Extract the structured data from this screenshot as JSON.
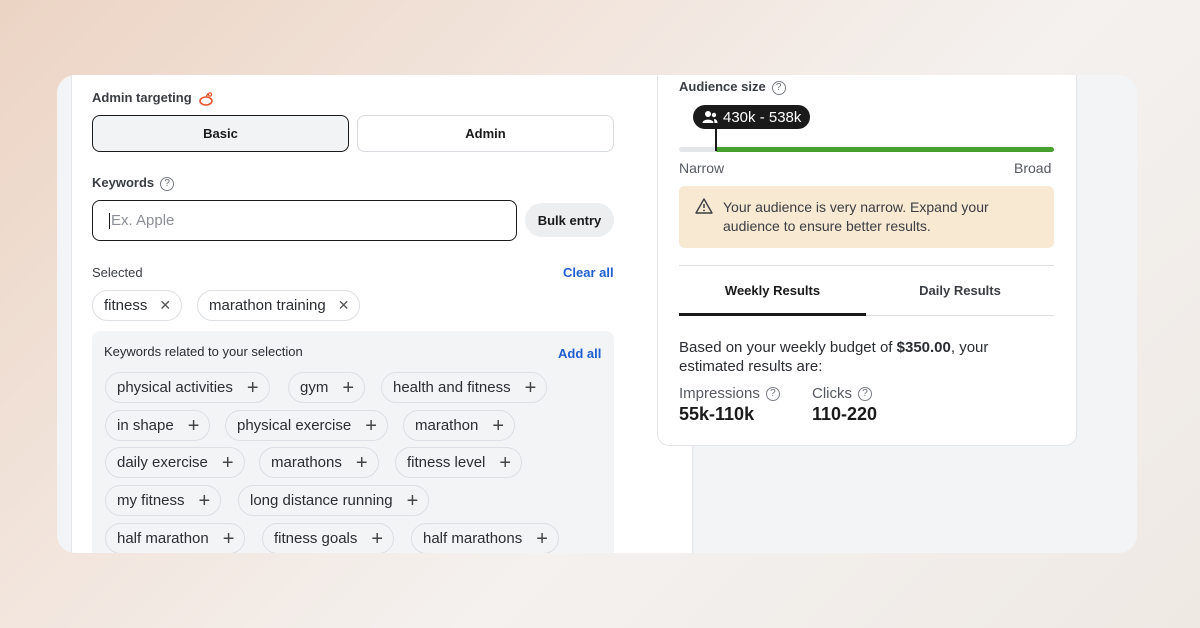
{
  "targeting": {
    "label": "Admin targeting",
    "modes": [
      "Basic",
      "Admin"
    ],
    "selected_mode": "Basic"
  },
  "keywords": {
    "label": "Keywords",
    "input_placeholder": "Ex. Apple",
    "input_value": "",
    "bulk_label": "Bulk entry"
  },
  "selected": {
    "label": "Selected",
    "clear_label": "Clear all",
    "chips": [
      "fitness",
      "marathon training"
    ]
  },
  "related": {
    "title": "Keywords related to your selection",
    "add_all_label": "Add all",
    "chips": [
      "physical activities",
      "gym",
      "health and fitness",
      "in shape",
      "physical exercise",
      "marathon",
      "daily exercise",
      "marathons",
      "fitness level",
      "my fitness",
      "long distance running",
      "half marathon",
      "fitness goals",
      "half marathons"
    ]
  },
  "audience": {
    "label": "Audience size",
    "range": "430k - 538k",
    "narrow_label": "Narrow",
    "broad_label": "Broad",
    "level": 0.1,
    "accent_color": "#46a02e",
    "warning": "Your audience is very narrow. Expand your audience to ensure better results."
  },
  "results": {
    "tabs": [
      "Weekly Results",
      "Daily Results"
    ],
    "active_tab": "Weekly Results",
    "budget_prefix": "Based on your weekly budget of ",
    "budget_amount": "$350.00",
    "budget_suffix": ", your estimated results are:",
    "impressions_label": "Impressions",
    "impressions_value": "55k-110k",
    "clicks_label": "Clicks",
    "clicks_value": "110-220"
  }
}
